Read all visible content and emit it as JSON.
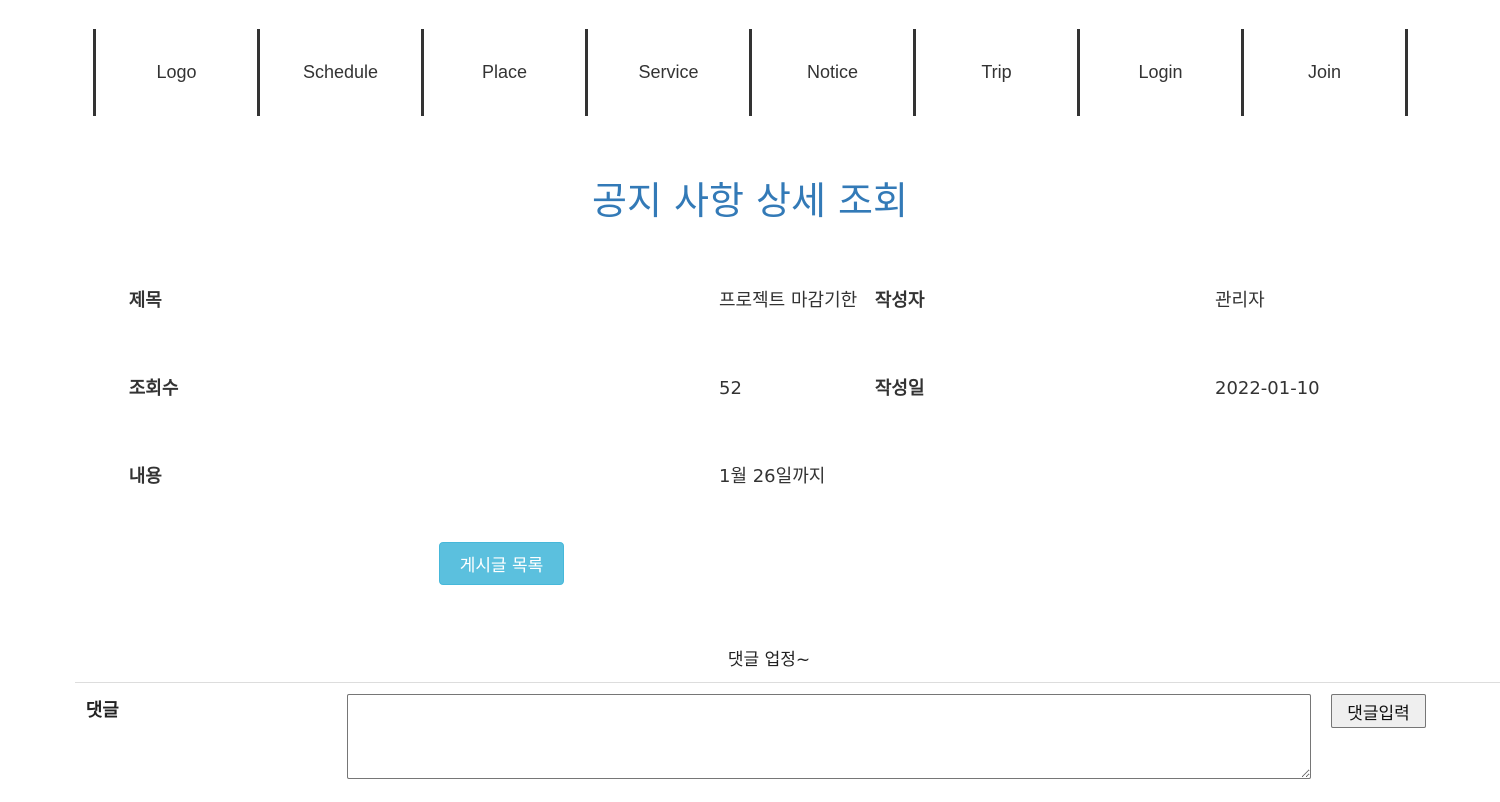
{
  "nav": {
    "items": [
      {
        "label": "Logo"
      },
      {
        "label": "Schedule"
      },
      {
        "label": "Place"
      },
      {
        "label": "Service"
      },
      {
        "label": "Notice"
      },
      {
        "label": "Trip"
      },
      {
        "label": "Login"
      },
      {
        "label": "Join"
      }
    ]
  },
  "page": {
    "title": "공지 사항 상세 조회"
  },
  "detail": {
    "title_label": "제목",
    "title_value": "프로젝트 마감기한",
    "author_label": "작성자",
    "author_value": "관리자",
    "views_label": "조회수",
    "views_value": "52",
    "date_label": "작성일",
    "date_value": "2022-01-10",
    "content_label": "내용",
    "content_value": "1월 26일까지"
  },
  "actions": {
    "list_button": "게시글 목록"
  },
  "comments": {
    "notice": "댓글 업정~",
    "label": "댓글",
    "textarea_value": "",
    "submit_button": "댓글입력"
  },
  "colors": {
    "title": "#337ab7",
    "list_button_bg": "#5bc0de",
    "nav_border": "#333333"
  }
}
